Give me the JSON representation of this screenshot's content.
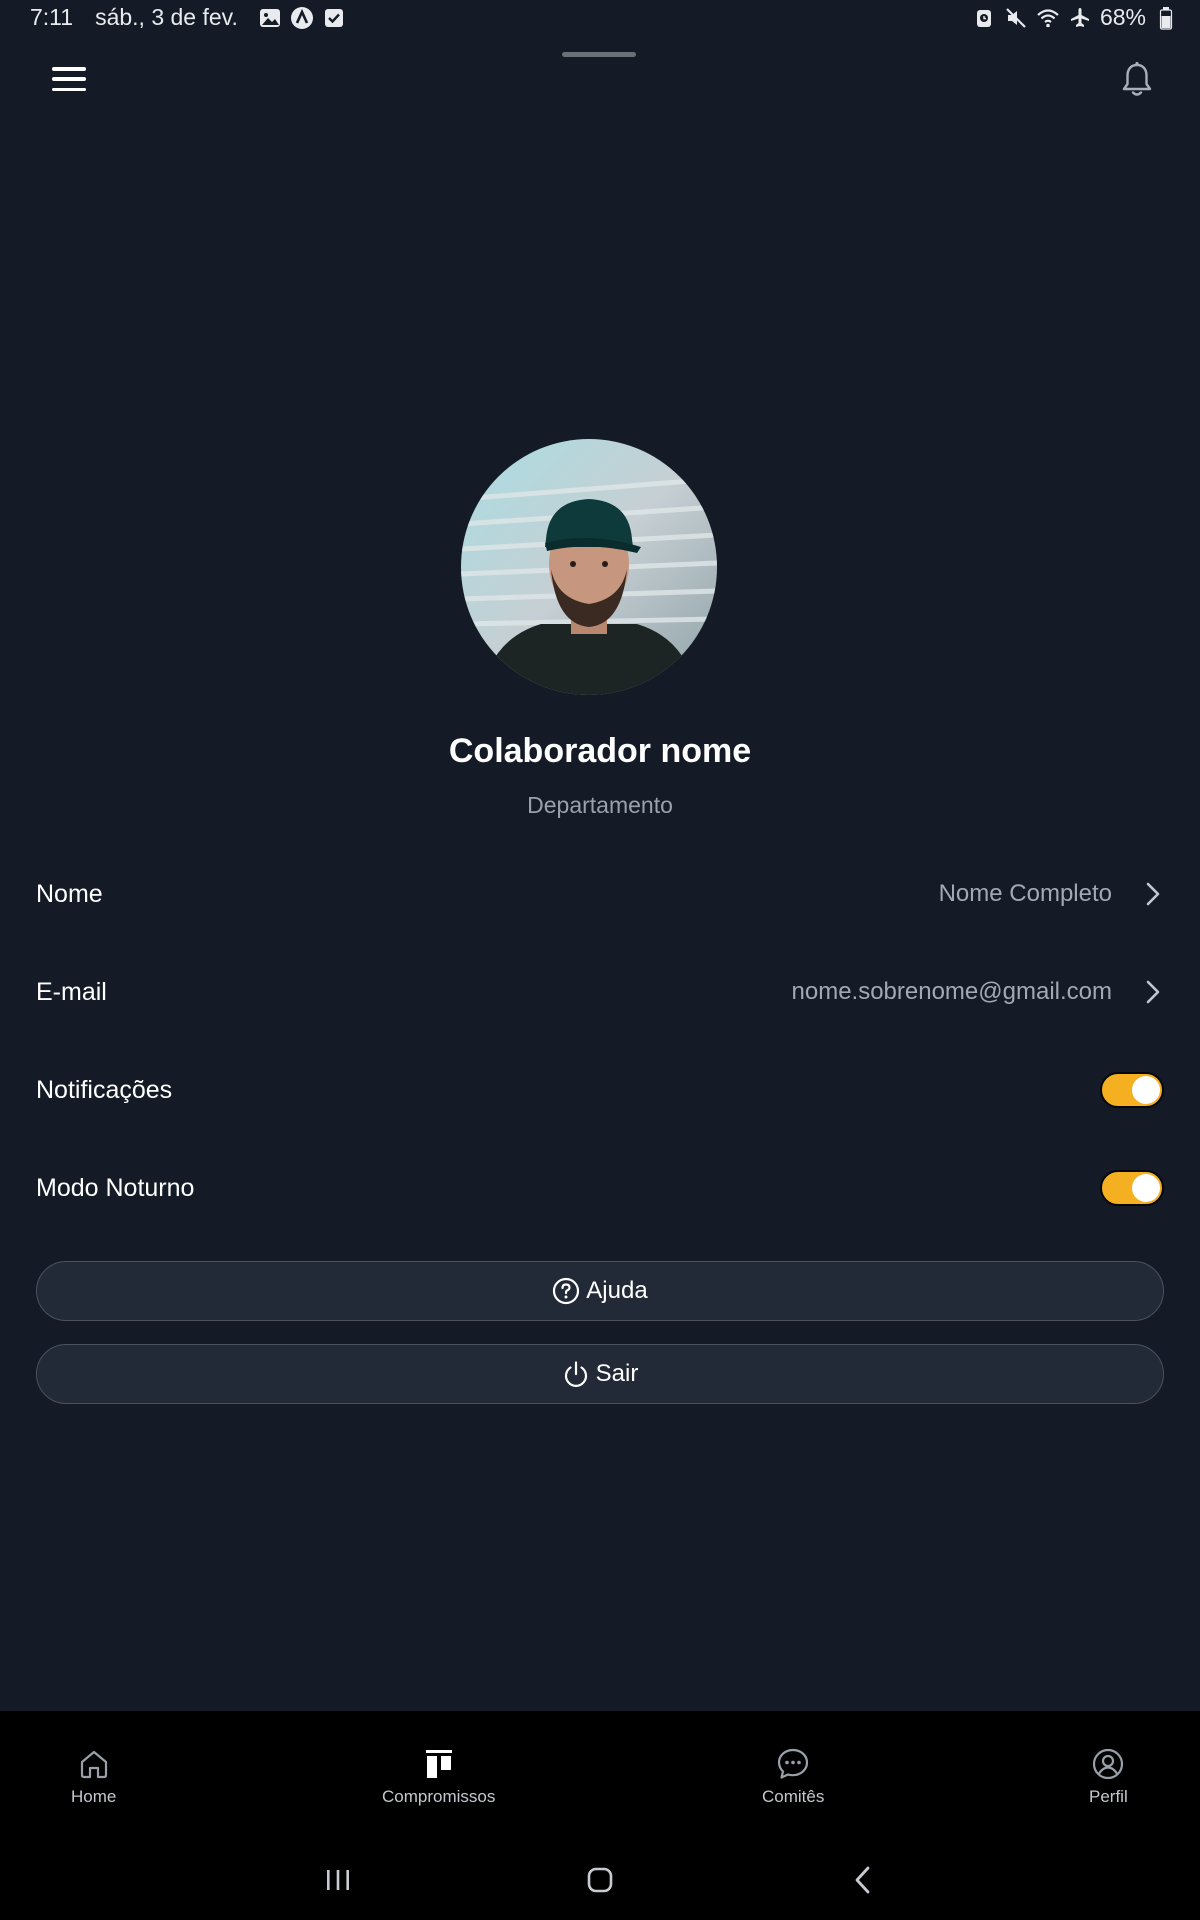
{
  "status_bar": {
    "time": "7:11",
    "date": "sáb., 3 de fev.",
    "battery": "68%",
    "left_icons": [
      "gallery-icon",
      "app-a-icon",
      "checkbox-icon"
    ],
    "right_icons": [
      "alarm-icon",
      "mute-icon",
      "wifi-icon",
      "airplane-icon",
      "battery-icon"
    ]
  },
  "header": {
    "menu_icon": "hamburger-menu-icon",
    "notification_icon": "bell-icon"
  },
  "profile": {
    "name": "Colaborador nome",
    "department": "Departamento"
  },
  "settings": {
    "name": {
      "label": "Nome",
      "value": "Nome Completo"
    },
    "email": {
      "label": "E-mail",
      "value": "nome.sobrenome@gmail.com"
    },
    "notifications": {
      "label": "Notificações",
      "enabled": true
    },
    "night_mode": {
      "label": "Modo Noturno",
      "enabled": true
    }
  },
  "buttons": {
    "help": "Ajuda",
    "logout": "Sair"
  },
  "bottom_nav": {
    "home": "Home",
    "compromissos": "Compromissos",
    "comites": "Comitês",
    "perfil": "Perfil"
  },
  "colors": {
    "background": "#141a26",
    "toggle_on": "#f4b020",
    "button_bg": "#222a38",
    "nav_bg": "#000000",
    "muted_text": "#a3a9b3"
  }
}
